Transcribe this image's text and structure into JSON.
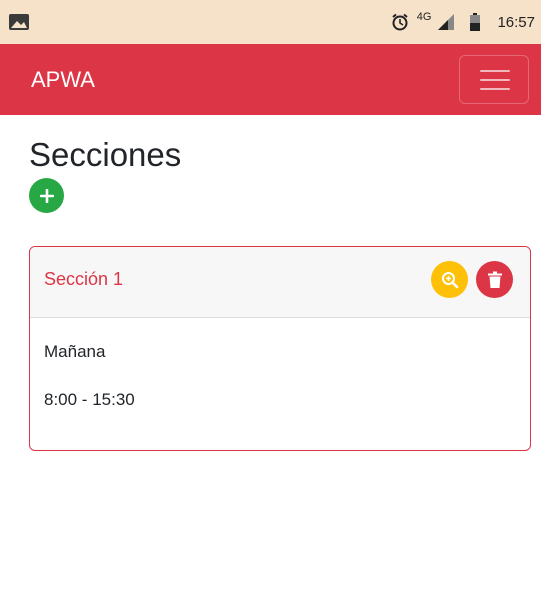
{
  "status_bar": {
    "network": "4G",
    "time": "16:57"
  },
  "navbar": {
    "brand": "APWA",
    "menu_icon": "hamburger-menu-icon"
  },
  "page": {
    "title": "Secciones",
    "add_icon": "plus-icon"
  },
  "sections": [
    {
      "name": "Sección 1",
      "shift": "Mañana",
      "hours": "8:00 - 15:30",
      "actions": [
        {
          "icon": "zoom-in-icon",
          "color": "#ffc107"
        },
        {
          "icon": "trash-icon",
          "color": "#dc3545"
        }
      ]
    }
  ],
  "colors": {
    "primary": "#dc3545",
    "success": "#28a745",
    "warning": "#ffc107",
    "status_bar": "#f6e1c9"
  }
}
